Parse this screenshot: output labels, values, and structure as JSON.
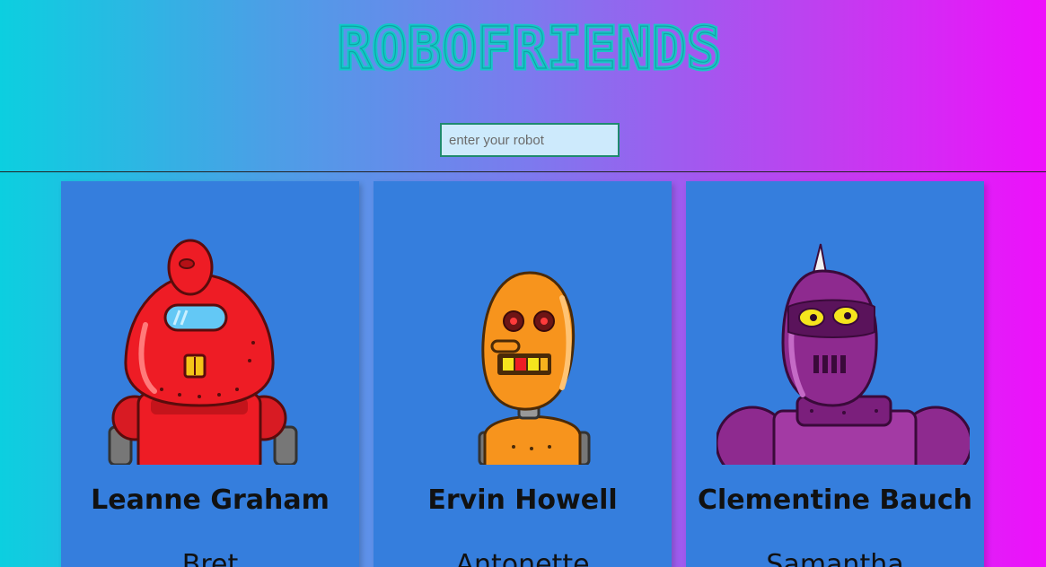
{
  "app": {
    "title": "ROBOFRIENDS"
  },
  "search": {
    "placeholder": "enter your robot",
    "value": ""
  },
  "cards": [
    {
      "name": "Leanne Graham",
      "sub": "Bret",
      "robot_color": "#ee1c25"
    },
    {
      "name": "Ervin Howell",
      "sub": "Antonette",
      "robot_color": "#f7941d"
    },
    {
      "name": "Clementine Bauch",
      "sub": "Samantha",
      "robot_color": "#8e2a8f"
    }
  ],
  "colors": {
    "logo_fill": "#12c7c4",
    "card_bg": "#357edd",
    "search_bg": "#cdeafc",
    "search_border": "#1f8a6f"
  }
}
